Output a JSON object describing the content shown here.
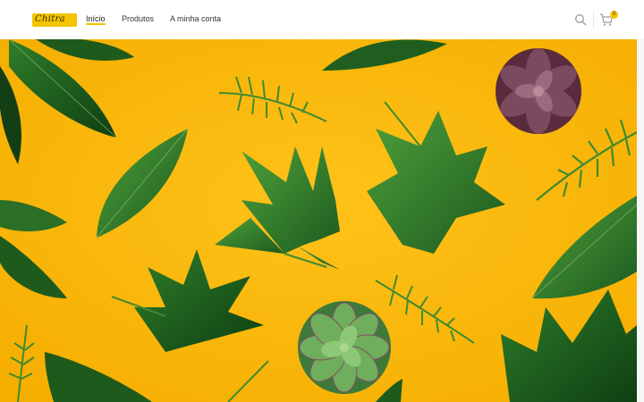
{
  "brand": {
    "logo_text": "Chitra",
    "accent_color": "#f2c500"
  },
  "nav": {
    "items": [
      {
        "label": "Início",
        "active": true
      },
      {
        "label": "Produtos",
        "active": false
      },
      {
        "label": "A minha conta",
        "active": false
      }
    ]
  },
  "header_actions": {
    "search_icon": "search-icon",
    "cart_icon": "shopping-cart-icon",
    "cart_count": "0"
  },
  "hero": {
    "background_color": "#f7b90f",
    "image_subject": "green leaves, ferns and succulents on yellow background"
  }
}
